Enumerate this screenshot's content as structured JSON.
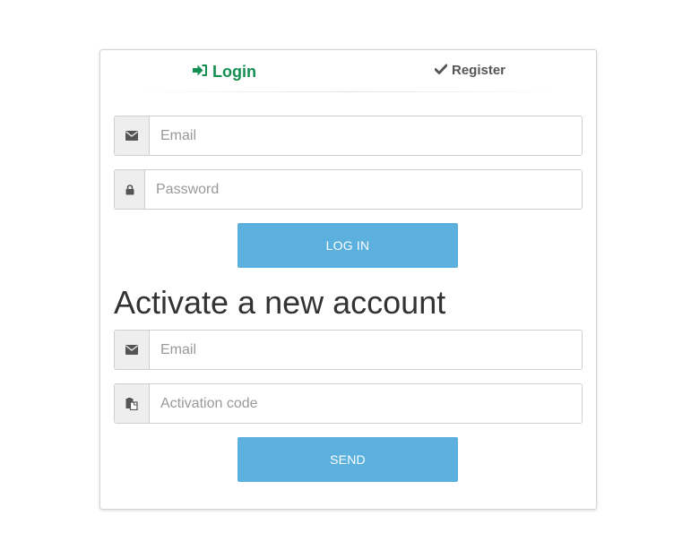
{
  "tabs": {
    "login_label": "Login",
    "register_label": "Register"
  },
  "login_form": {
    "email_placeholder": "Email",
    "password_placeholder": "Password",
    "submit_label": "LOG IN"
  },
  "activate_form": {
    "title": "Activate a new account",
    "email_placeholder": "Email",
    "code_placeholder": "Activation code",
    "submit_label": "SEND"
  },
  "icons": {
    "login_tab": "sign-in-icon",
    "register_tab": "check-icon",
    "email": "envelope-icon",
    "password": "lock-icon",
    "activation_code": "paste-icon"
  },
  "colors": {
    "accent_green": "#138f52",
    "button_blue": "#5bb0de",
    "addon_gray": "#eeeeee"
  }
}
